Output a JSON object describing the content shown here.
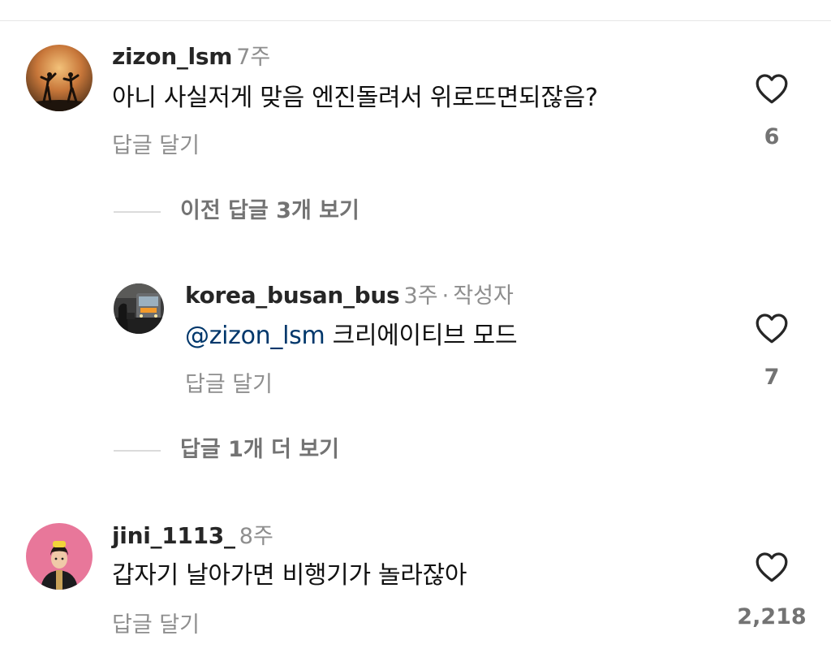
{
  "comments": [
    {
      "username": "zizon_lsm",
      "time": "7주",
      "text": "아니 사실저게 맞음 엔진돌려서 위로뜨면되잖음?",
      "reply_label": "답글 달기",
      "likes": "6",
      "avatar": "silhouette-sunset-avatar"
    },
    {
      "username": "korea_busan_bus",
      "time": "3주",
      "separator": "·",
      "author_tag": "작성자",
      "mention": "@zizon_lsm",
      "text": "크리에이티브 모드",
      "reply_label": "답글 달기",
      "likes": "7",
      "avatar": "bus-photo-avatar"
    },
    {
      "username": "jini_1113_",
      "time": "8주",
      "text": "갑자기 날아가면 비행기가 놀라잖아",
      "reply_label": "답글 달기",
      "likes": "2,218",
      "avatar": "person-pink-avatar"
    }
  ],
  "threads": {
    "view_previous": "이전 답글 3개 보기",
    "view_more": "답글 1개 더 보기"
  },
  "icons": {
    "like": "heart-outline-icon"
  },
  "colors": {
    "mention": "#00376b",
    "secondary_text": "#8e8e8e",
    "count_text": "#737373",
    "divider": "#dbdbdb"
  }
}
